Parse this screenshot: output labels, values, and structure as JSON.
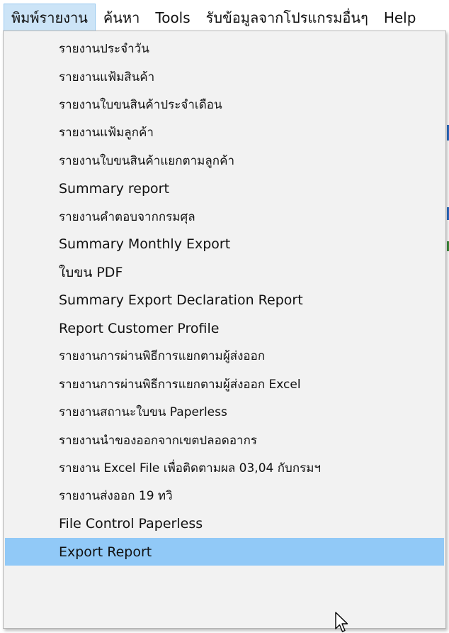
{
  "menubar": {
    "items": [
      {
        "label": "พิมพ์รายงาน",
        "active": true
      },
      {
        "label": "ค้นหา",
        "active": false
      },
      {
        "label": "Tools",
        "active": false
      },
      {
        "label": "รับข้อมูลจากโปรแกรมอื่นๆ",
        "active": false
      },
      {
        "label": "Help",
        "active": false
      }
    ]
  },
  "dropdown": {
    "items": [
      {
        "label": "รายงานประจำวัน"
      },
      {
        "label": "รายงานแฟ้มสินค้า"
      },
      {
        "label": "รายงานใบขนสินค้าประจำเดือน"
      },
      {
        "label": "รายงานแฟ้มลูกค้า"
      },
      {
        "label": "รายงานใบขนสินค้าแยกตามลูกค้า"
      },
      {
        "label": "Summary report"
      },
      {
        "label": "รายงานคำตอบจากกรมศุล"
      },
      {
        "label": "Summary Monthly Export"
      },
      {
        "label": "ใบขน PDF"
      },
      {
        "label": "Summary Export Declaration Report"
      },
      {
        "label": "Report Customer Profile"
      },
      {
        "label": "รายงานการผ่านพิธีการแยกตามผู้ส่งออก"
      },
      {
        "label": "รายงานการผ่านพิธีการแยกตามผู้ส่งออก Excel"
      },
      {
        "label": "รายงานสถานะใบขน Paperless"
      },
      {
        "label": "รายงานนำของออกจากเขตปลอดอากร"
      },
      {
        "label": "รายงาน Excel File เพื่อติดตามผล 03,04 กับกรมฯ"
      },
      {
        "label": "รายงานส่งออก 19 ทวิ"
      },
      {
        "label": "File Control Paperless"
      },
      {
        "label": "Export Report"
      }
    ],
    "highlighted": "Export Report"
  },
  "icons": {
    "cursor": "mouse-pointer-icon"
  },
  "colors": {
    "menubar_active_bg": "#cce4f7",
    "menu_bg": "#f2f2f2",
    "highlight_bg": "#91c9f7"
  }
}
